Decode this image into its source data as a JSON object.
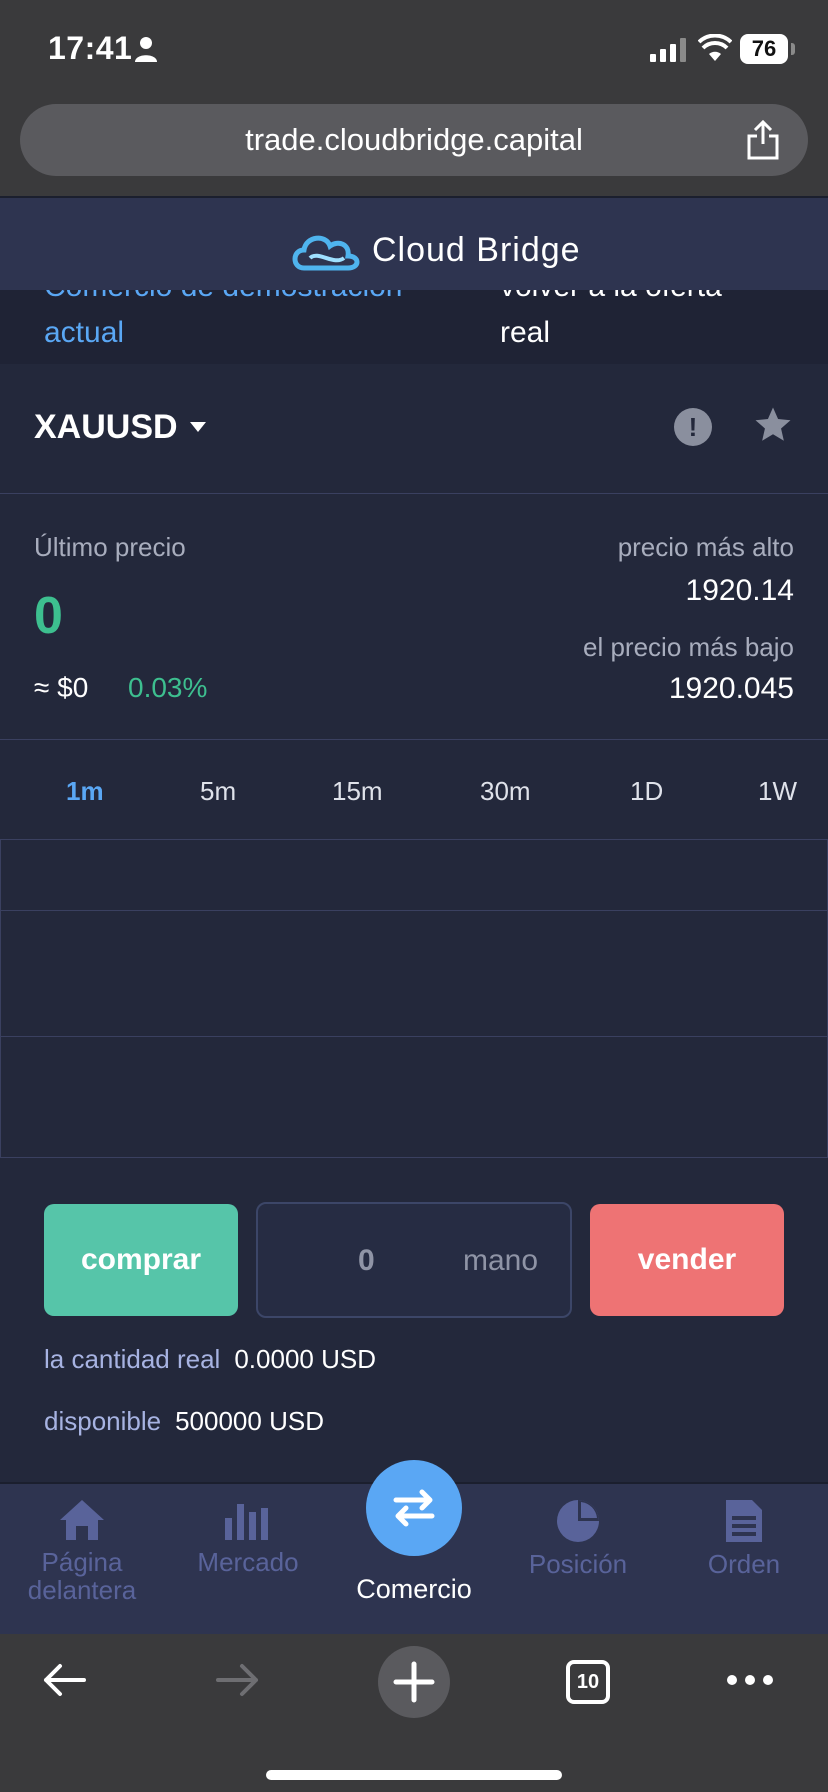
{
  "status_bar": {
    "time": "17:41",
    "battery": "76"
  },
  "browser": {
    "url": "trade.cloudbridge.capital",
    "tab_count": "10"
  },
  "header": {
    "logo_text": "Cloud Bridge"
  },
  "demo": {
    "left_line1": "Comercio de demostración",
    "left_line2": "actual",
    "right_line1": "volver a la oferta",
    "right_line2": "real"
  },
  "symbol": {
    "name": "XAUUSD"
  },
  "price": {
    "last_label": "Último precio",
    "last_value": "0",
    "approx": "≈ $0",
    "change": "0.03%",
    "high_label": "precio más alto",
    "high_value": "1920.14",
    "low_label": "el precio más bajo",
    "low_value": "1920.045"
  },
  "timeframes": [
    "1m",
    "5m",
    "15m",
    "30m",
    "1D",
    "1W"
  ],
  "active_timeframe": "1m",
  "order": {
    "buy_label": "comprar",
    "sell_label": "vender",
    "qty_value": "0",
    "qty_unit": "mano",
    "amount_label": "la cantidad real",
    "amount_value": "0.0000 USD",
    "available_label": "disponible",
    "available_value": "500000 USD"
  },
  "nav": {
    "home_line1": "Página",
    "home_line2": "delantera",
    "market": "Mercado",
    "trade": "Comercio",
    "position": "Posición",
    "order": "Orden"
  },
  "colors": {
    "buy": "#56c5a9",
    "sell": "#ee7374",
    "accent": "#5aa7f4",
    "positive": "#3dbf8f",
    "background": "#23283b"
  }
}
